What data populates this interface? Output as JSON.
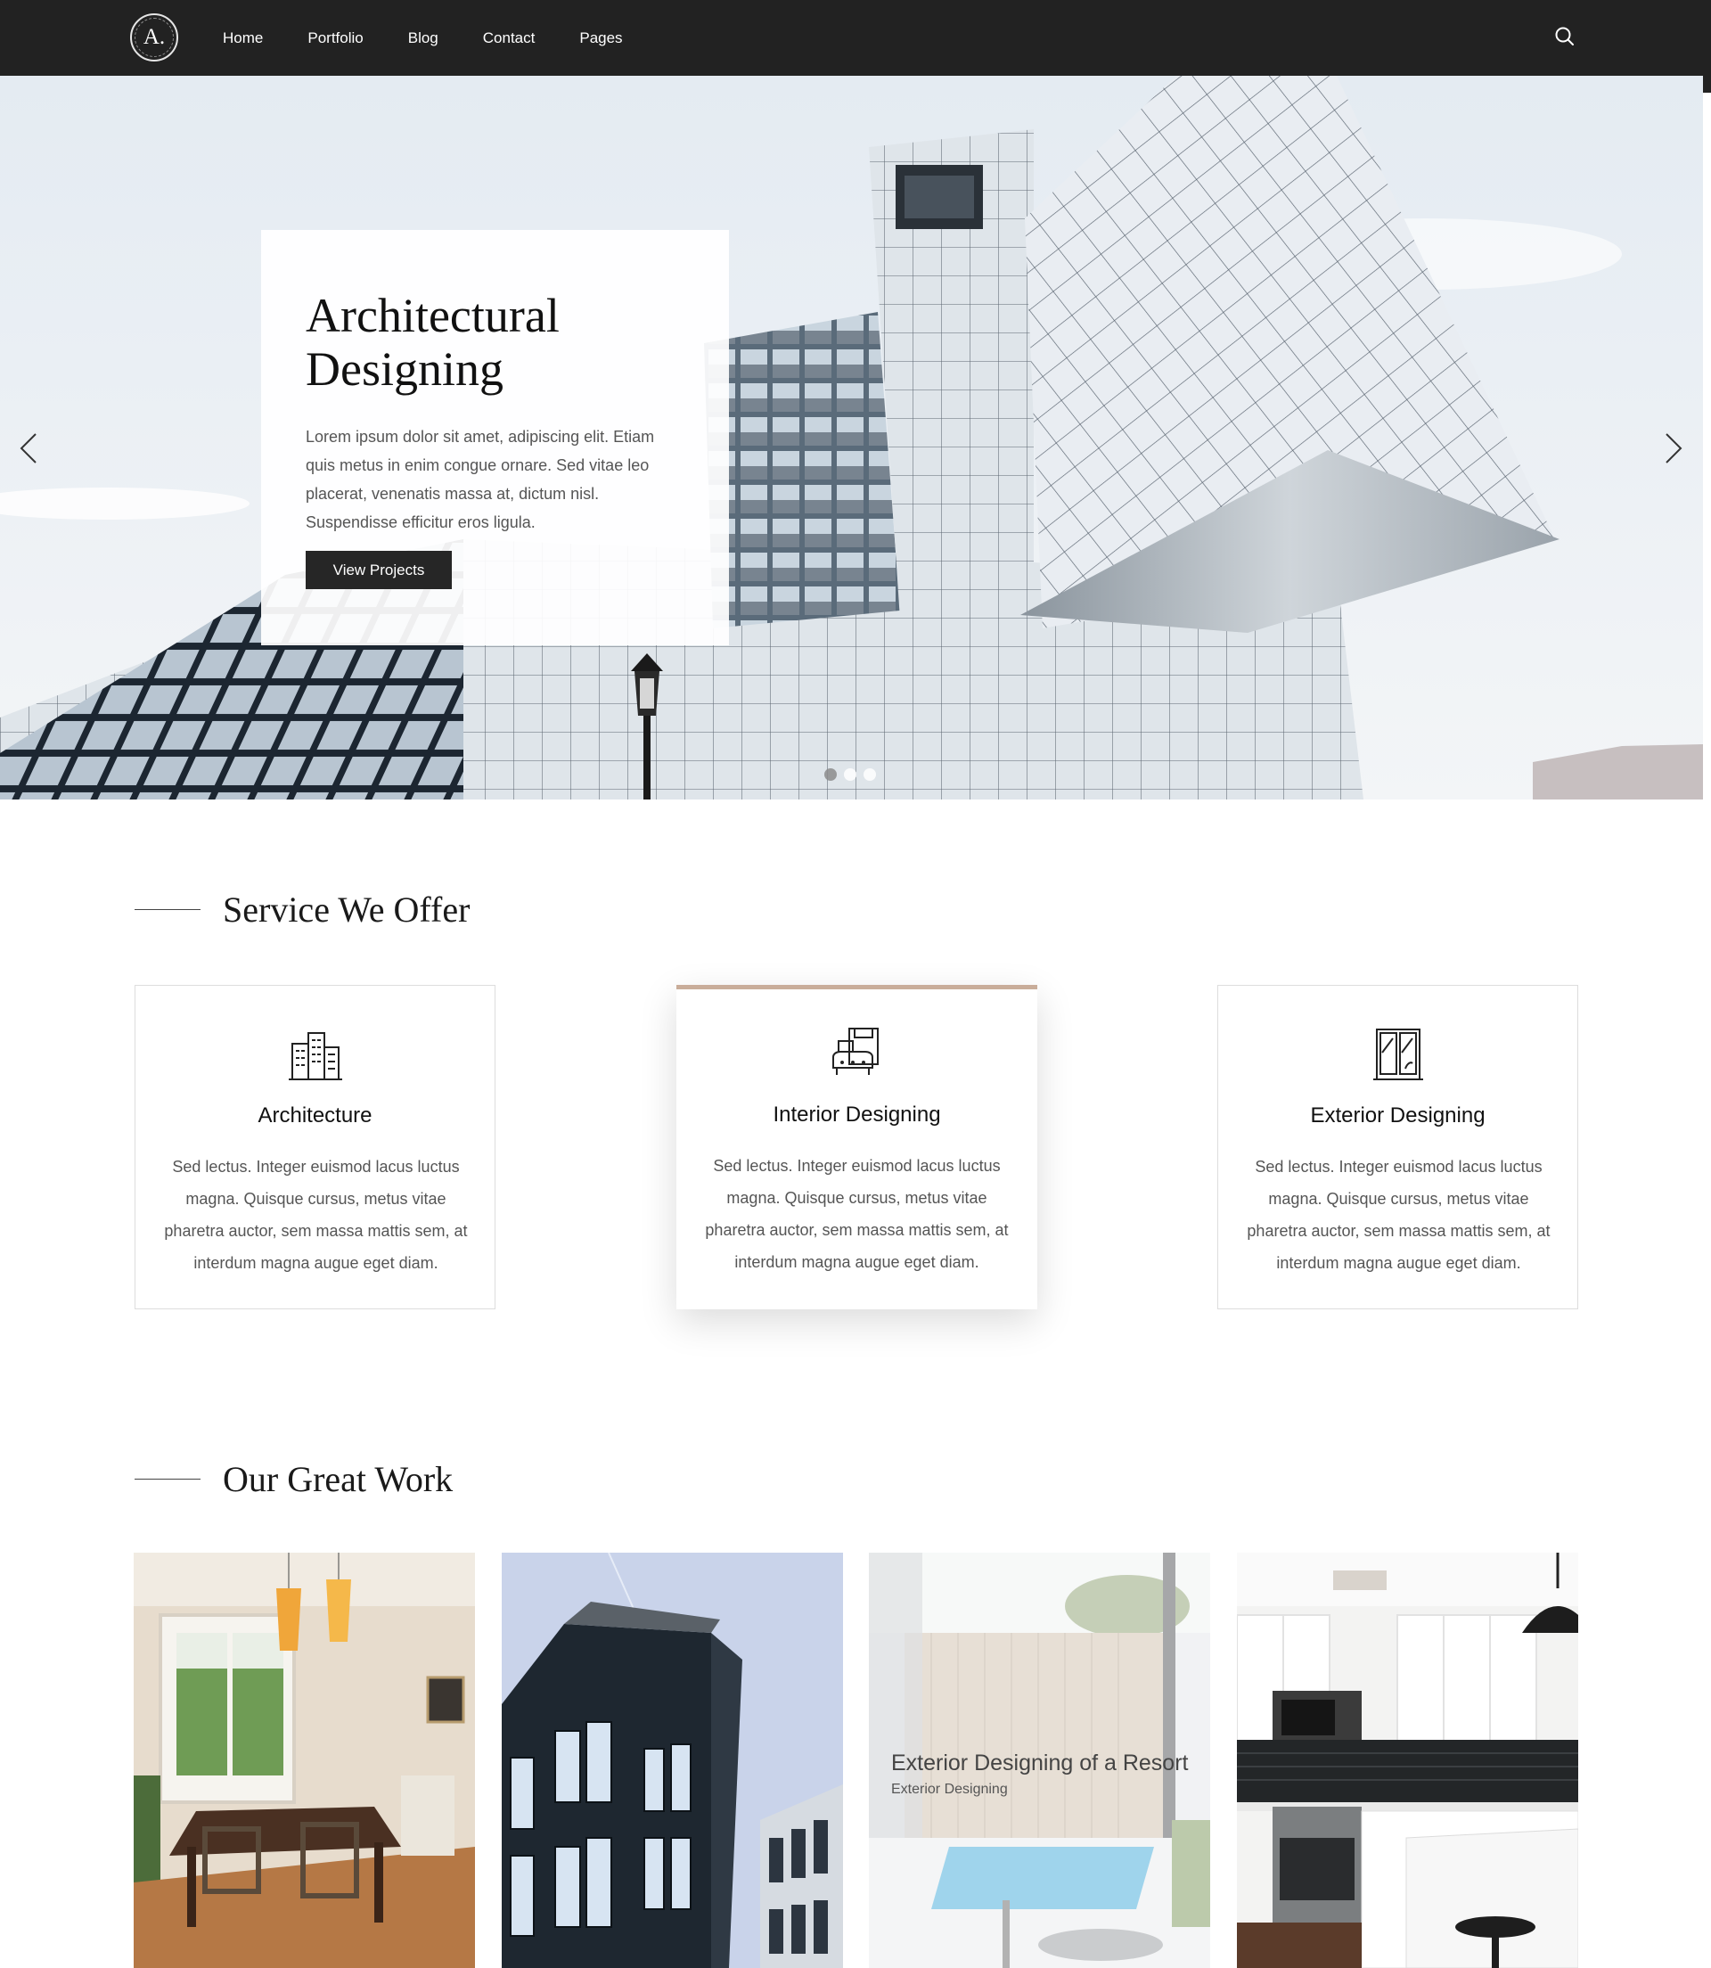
{
  "header": {
    "logo_text": "A.",
    "nav": [
      "Home",
      "Portfolio",
      "Blog",
      "Contact",
      "Pages"
    ],
    "search_icon": "search-icon"
  },
  "hero": {
    "title": "Architectural Designing",
    "text": "Lorem ipsum dolor sit amet, adipiscing elit. Etiam quis metus in enim congue ornare. Sed vitae leo placerat, venenatis massa at, dictum nisl. Suspendisse efficitur eros ligula.",
    "button": "View Projects",
    "slides": 3,
    "active_slide": 1
  },
  "services": {
    "heading": "Service We Offer",
    "items": [
      {
        "title": "Architecture",
        "icon": "buildings-icon",
        "text": "Sed lectus. Integer euismod lacus luctus magna. Quisque cursus, metus vitae pharetra auctor, sem massa mattis sem, at interdum magna augue eget diam."
      },
      {
        "title": "Interior Designing",
        "icon": "armchair-icon",
        "text": "Sed lectus. Integer euismod lacus luctus magna. Quisque cursus, metus vitae pharetra auctor, sem massa mattis sem, at interdum magna augue eget diam."
      },
      {
        "title": "Exterior Designing",
        "icon": "window-icon",
        "text": "Sed lectus. Integer euismod lacus luctus magna. Quisque cursus, metus vitae pharetra auctor, sem massa mattis sem, at interdum magna augue eget diam."
      }
    ]
  },
  "work": {
    "heading": "Our Great Work",
    "hover_item": {
      "title": "Exterior Designing of a Resort",
      "category": "Exterior Designing"
    }
  },
  "colors": {
    "header_bg": "#222222",
    "accent": "#c9ad9a",
    "button_bg": "#262626"
  }
}
